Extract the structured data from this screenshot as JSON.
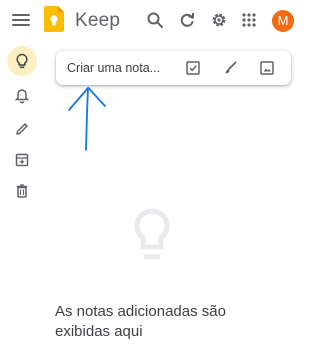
{
  "header": {
    "app_title": "Keep",
    "avatar_letter": "M"
  },
  "sidebar": {
    "items": [
      {
        "name": "notes",
        "icon": "lightbulb-icon",
        "active": true
      },
      {
        "name": "reminders",
        "icon": "bell-icon",
        "active": false
      },
      {
        "name": "edit-labels",
        "icon": "pencil-icon",
        "active": false
      },
      {
        "name": "archive",
        "icon": "archive-icon",
        "active": false
      },
      {
        "name": "trash",
        "icon": "trash-icon",
        "active": false
      }
    ]
  },
  "note_input": {
    "placeholder": "Criar uma nota...",
    "tools": [
      "checkbox-icon",
      "brush-icon",
      "image-icon"
    ]
  },
  "empty_state": {
    "message": "As notas adicionadas são exibidas aqui"
  },
  "colors": {
    "accent_yellow": "#fbbc04",
    "active_bg": "#feefc3",
    "avatar": "#f16b12",
    "annotation_arrow": "#1a73e8",
    "icon_gray": "#5f6368"
  }
}
